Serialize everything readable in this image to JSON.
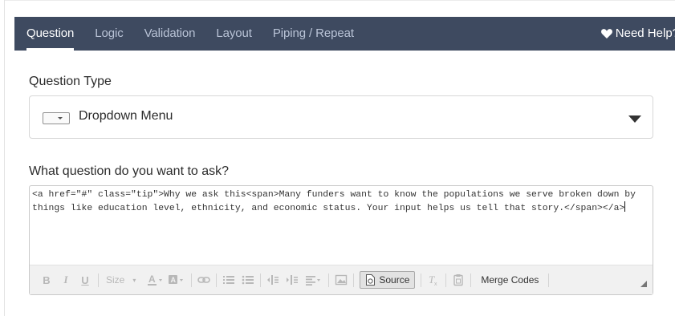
{
  "tabs": [
    {
      "label": "Question",
      "active": true
    },
    {
      "label": "Logic",
      "active": false
    },
    {
      "label": "Validation",
      "active": false
    },
    {
      "label": "Layout",
      "active": false
    },
    {
      "label": "Piping / Repeat",
      "active": false
    }
  ],
  "help": {
    "label": "Need Help?",
    "icon": "heart-icon"
  },
  "question_type": {
    "label": "Question Type",
    "value": "Dropdown Menu",
    "icon": "dropdown-menu-icon"
  },
  "question": {
    "label": "What question do you want to ask?",
    "source_text": "<a href=\"#\" class=\"tip\">Why we ask this<span>Many funders want to know the populations we serve broken down by things like education level, ethnicity, and economic status. Your input helps us tell that story.</span></a>"
  },
  "toolbar": {
    "bold": "B",
    "italic": "I",
    "underline": "U",
    "size": "Size",
    "source": "Source",
    "merge_codes": "Merge Codes"
  },
  "colors": {
    "tabbar_bg": "#3e4a60",
    "tab_inactive": "#b9c3d6",
    "tab_active": "#ffffff"
  }
}
